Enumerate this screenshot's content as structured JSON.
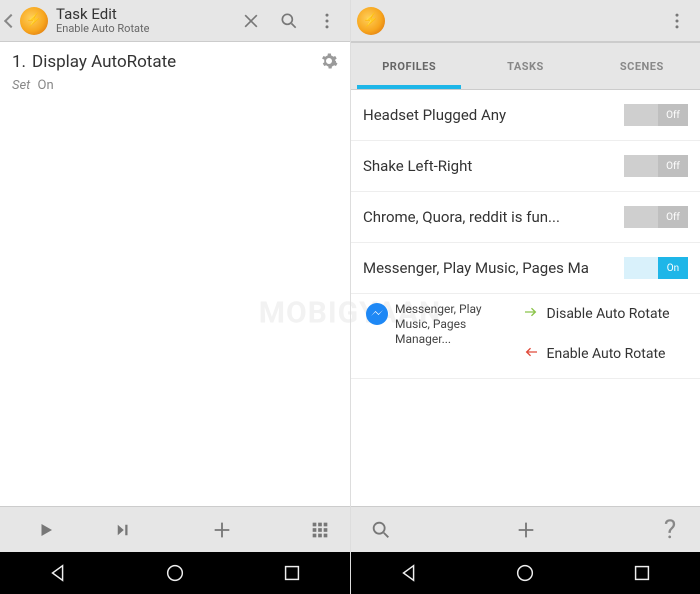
{
  "left": {
    "header": {
      "title": "Task Edit",
      "subtitle": "Enable Auto Rotate"
    },
    "task": {
      "index": "1.",
      "name": "Display AutoRotate",
      "set_label": "Set",
      "set_value": "On"
    },
    "bottom": {
      "play": "play",
      "next": "next",
      "add": "add",
      "grid": "grid"
    }
  },
  "right": {
    "tabs": {
      "profiles": "PROFILES",
      "tasks": "TASKS",
      "scenes": "SCENES"
    },
    "profiles": [
      {
        "label": "Headset Plugged Any",
        "state": "Off"
      },
      {
        "label": "Shake Left-Right",
        "state": "Off"
      },
      {
        "label": "Chrome, Quora, reddit is fun...",
        "state": "Off"
      },
      {
        "label": "Messenger, Play Music, Pages Ma",
        "state": "On"
      }
    ],
    "expanded": {
      "context_label": "Messenger, Play Music, Pages Manager...",
      "enter_task": "Disable Auto Rotate",
      "exit_task": "Enable Auto Rotate"
    },
    "bottom": {
      "search": "search",
      "add": "add",
      "help": "?"
    }
  },
  "watermark": "MOBIGYAAN"
}
